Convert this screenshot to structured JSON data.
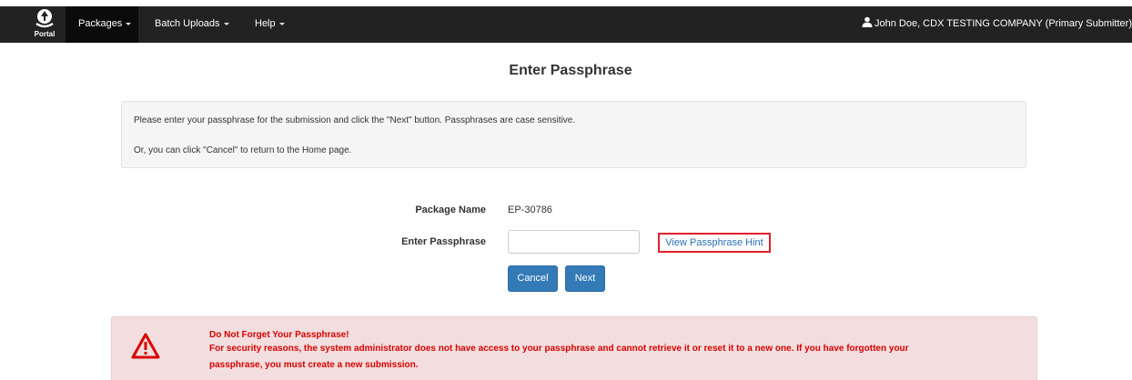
{
  "navbar": {
    "logo_label": "Portal",
    "menus": [
      {
        "label": "Packages"
      },
      {
        "label": "Batch Uploads"
      },
      {
        "label": "Help"
      }
    ],
    "user_label": "John Doe, CDX TESTING COMPANY (Primary Submitter)"
  },
  "page": {
    "title": "Enter Passphrase"
  },
  "info": {
    "line1": "Please enter your passphrase for the submission and click the \"Next\" button. Passphrases are case sensitive.",
    "line2": "Or, you can click \"Cancel\" to return to the Home page."
  },
  "form": {
    "package_name_label": "Package Name",
    "package_name_value": "EP-30786",
    "passphrase_label": "Enter Passphrase",
    "passphrase_value": "",
    "hint_link": "View Passphrase Hint",
    "cancel_label": "Cancel",
    "next_label": "Next"
  },
  "alert": {
    "heading": "Do Not Forget Your Passphrase!",
    "line1": "For security reasons, the system administrator does not have access to your passphrase and cannot retrieve it or reset it to a new one. If you have forgotten your",
    "line2": "passphrase, you must create a new submission."
  },
  "colors": {
    "navbar": "#222222",
    "primary_button": "#337ab7",
    "link": "#2a6fb5",
    "danger_text": "#d90000",
    "danger_bg": "#f2dede",
    "highlight_border": "#e01f2d"
  }
}
